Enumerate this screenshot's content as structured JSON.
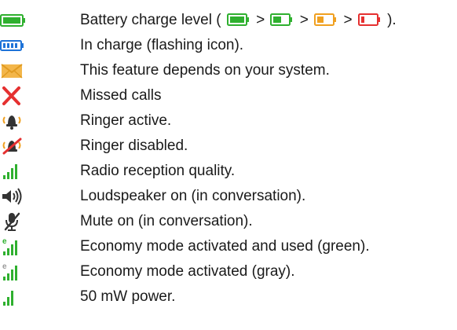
{
  "legend": {
    "rows": [
      {
        "icon": "battery-full-icon",
        "label": "Battery charge level (",
        "suffix": ")."
      },
      {
        "icon": "battery-charging-icon",
        "label": "In charge (flashing icon)."
      },
      {
        "icon": "envelope-icon",
        "label": "This feature depends on your system."
      },
      {
        "icon": "missed-call-x-icon",
        "label": "Missed calls"
      },
      {
        "icon": "ringer-active-icon",
        "label": "Ringer active."
      },
      {
        "icon": "ringer-disabled-icon",
        "label": "Ringer disabled."
      },
      {
        "icon": "signal-bars-icon",
        "label": "Radio reception quality."
      },
      {
        "icon": "loudspeaker-icon",
        "label": "Loudspeaker on (in conversation)."
      },
      {
        "icon": "mute-microphone-icon",
        "label": "Mute on (in conversation)."
      },
      {
        "icon": "economy-mode-green-icon",
        "label": "Economy mode activated and used (green)."
      },
      {
        "icon": "economy-mode-gray-icon",
        "label": "Economy mode activated (gray)."
      },
      {
        "icon": "power-50mw-icon",
        "label": "50 mW power."
      }
    ],
    "battery_separator": ">",
    "colors": {
      "green": "#2fb02f",
      "blue": "#1e73d8",
      "orange": "#f0a020",
      "red": "#e53030",
      "gray": "#9a9a9a",
      "dark": "#333333"
    }
  }
}
